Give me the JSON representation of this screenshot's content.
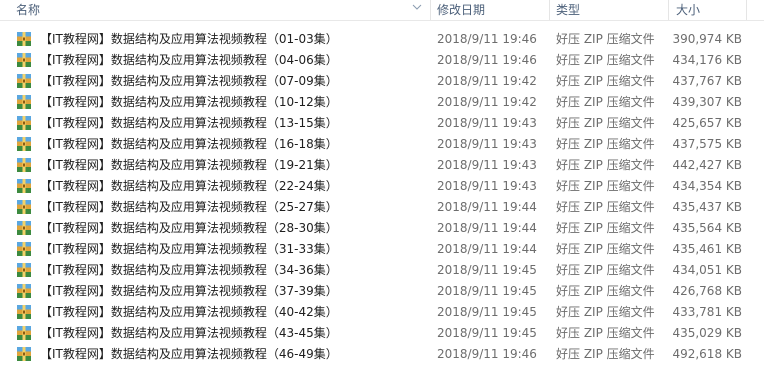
{
  "header": {
    "name": "名称",
    "modified": "修改日期",
    "type": "类型",
    "size": "大小"
  },
  "files": [
    {
      "name": "【IT教程网】数据结构及应用算法视频教程（01-03集）",
      "date": "2018/9/11 19:46",
      "type": "好压 ZIP 压缩文件",
      "size": "390,974 KB"
    },
    {
      "name": "【IT教程网】数据结构及应用算法视频教程（04-06集）",
      "date": "2018/9/11 19:46",
      "type": "好压 ZIP 压缩文件",
      "size": "434,176 KB"
    },
    {
      "name": "【IT教程网】数据结构及应用算法视频教程（07-09集）",
      "date": "2018/9/11 19:42",
      "type": "好压 ZIP 压缩文件",
      "size": "437,767 KB"
    },
    {
      "name": "【IT教程网】数据结构及应用算法视频教程（10-12集）",
      "date": "2018/9/11 19:42",
      "type": "好压 ZIP 压缩文件",
      "size": "439,307 KB"
    },
    {
      "name": "【IT教程网】数据结构及应用算法视频教程（13-15集）",
      "date": "2018/9/11 19:43",
      "type": "好压 ZIP 压缩文件",
      "size": "425,657 KB"
    },
    {
      "name": "【IT教程网】数据结构及应用算法视频教程（16-18集）",
      "date": "2018/9/11 19:43",
      "type": "好压 ZIP 压缩文件",
      "size": "437,575 KB"
    },
    {
      "name": "【IT教程网】数据结构及应用算法视频教程（19-21集）",
      "date": "2018/9/11 19:43",
      "type": "好压 ZIP 压缩文件",
      "size": "442,427 KB"
    },
    {
      "name": "【IT教程网】数据结构及应用算法视频教程（22-24集）",
      "date": "2018/9/11 19:43",
      "type": "好压 ZIP 压缩文件",
      "size": "434,354 KB"
    },
    {
      "name": "【IT教程网】数据结构及应用算法视频教程（25-27集）",
      "date": "2018/9/11 19:44",
      "type": "好压 ZIP 压缩文件",
      "size": "435,437 KB"
    },
    {
      "name": "【IT教程网】数据结构及应用算法视频教程（28-30集）",
      "date": "2018/9/11 19:44",
      "type": "好压 ZIP 压缩文件",
      "size": "435,564 KB"
    },
    {
      "name": "【IT教程网】数据结构及应用算法视频教程（31-33集）",
      "date": "2018/9/11 19:44",
      "type": "好压 ZIP 压缩文件",
      "size": "435,461 KB"
    },
    {
      "name": "【IT教程网】数据结构及应用算法视频教程（34-36集）",
      "date": "2018/9/11 19:45",
      "type": "好压 ZIP 压缩文件",
      "size": "434,051 KB"
    },
    {
      "name": "【IT教程网】数据结构及应用算法视频教程（37-39集）",
      "date": "2018/9/11 19:45",
      "type": "好压 ZIP 压缩文件",
      "size": "426,768 KB"
    },
    {
      "name": "【IT教程网】数据结构及应用算法视频教程（40-42集）",
      "date": "2018/9/11 19:45",
      "type": "好压 ZIP 压缩文件",
      "size": "433,781 KB"
    },
    {
      "name": "【IT教程网】数据结构及应用算法视频教程（43-45集）",
      "date": "2018/9/11 19:45",
      "type": "好压 ZIP 压缩文件",
      "size": "435,029 KB"
    },
    {
      "name": "【IT教程网】数据结构及应用算法视频教程（46-49集）",
      "date": "2018/9/11 19:46",
      "type": "好压 ZIP 压缩文件",
      "size": "492,618 KB"
    }
  ],
  "icons": {
    "sort": "sort-ascending-chevron-icon",
    "file": "zip-archive-icon"
  },
  "colors": {
    "header_text": "#4c607a",
    "name_text": "#1e1e1e",
    "detail_text": "#6d6d6d"
  }
}
